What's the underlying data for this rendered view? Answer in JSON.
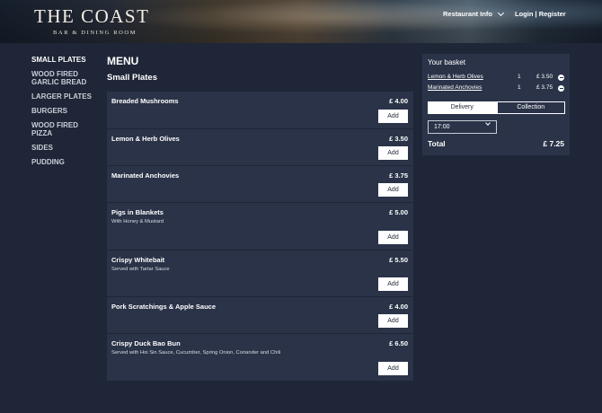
{
  "header": {
    "logo_title": "THE COAST",
    "logo_subtitle": "BAR & DINING ROOM",
    "restaurant_info": "Restaurant Info",
    "login": "Login",
    "separator": "|",
    "register": "Register"
  },
  "sidebar": {
    "items": [
      {
        "label": "SMALL PLATES",
        "active": true
      },
      {
        "label": "WOOD FIRED GARLIC BREAD",
        "active": false
      },
      {
        "label": "LARGER PLATES",
        "active": false
      },
      {
        "label": "BURGERS",
        "active": false
      },
      {
        "label": "WOOD FIRED PIZZA",
        "active": false
      },
      {
        "label": "SIDES",
        "active": false
      },
      {
        "label": "PUDDING",
        "active": false
      }
    ]
  },
  "main": {
    "title": "MENU",
    "section_title": "Small Plates",
    "add_label": "Add",
    "items": [
      {
        "name": "Breaded Mushrooms",
        "price": "£ 4.00",
        "description": ""
      },
      {
        "name": "Lemon & Herb Olives",
        "price": "£ 3.50",
        "description": ""
      },
      {
        "name": "Marinated Anchovies",
        "price": "£ 3.75",
        "description": ""
      },
      {
        "name": "Pigs in Blankets",
        "price": "£ 5.00",
        "description": "With Honey & Mustard"
      },
      {
        "name": "Crispy Whitebait",
        "price": "£ 5.50",
        "description": "Served with Tartar Sauce"
      },
      {
        "name": "Pork Scratchings & Apple Sauce",
        "price": "£ 4.00",
        "description": ""
      },
      {
        "name": "Crispy Duck Bao Bun",
        "price": "£ 6.50",
        "description": "Served with Hoi Sin Sauce, Cucumber, Spring Onion, Coriander and Chili"
      }
    ]
  },
  "basket": {
    "title": "Your basket",
    "lines": [
      {
        "name": "Lemon & Herb Olives",
        "qty": "1",
        "price": "£ 3.50"
      },
      {
        "name": "Marinated Anchovies",
        "qty": "1",
        "price": "£ 3.75"
      }
    ],
    "delivery_label": "Delivery",
    "collection_label": "Collection",
    "selected_mode": "Delivery",
    "time_value": "17:00",
    "total_label": "Total",
    "total_value": "£ 7.25"
  },
  "colors": {
    "background": "#1e2637",
    "panel": "#2a3348",
    "text": "#ffffff",
    "button_bg": "#ffffff"
  }
}
